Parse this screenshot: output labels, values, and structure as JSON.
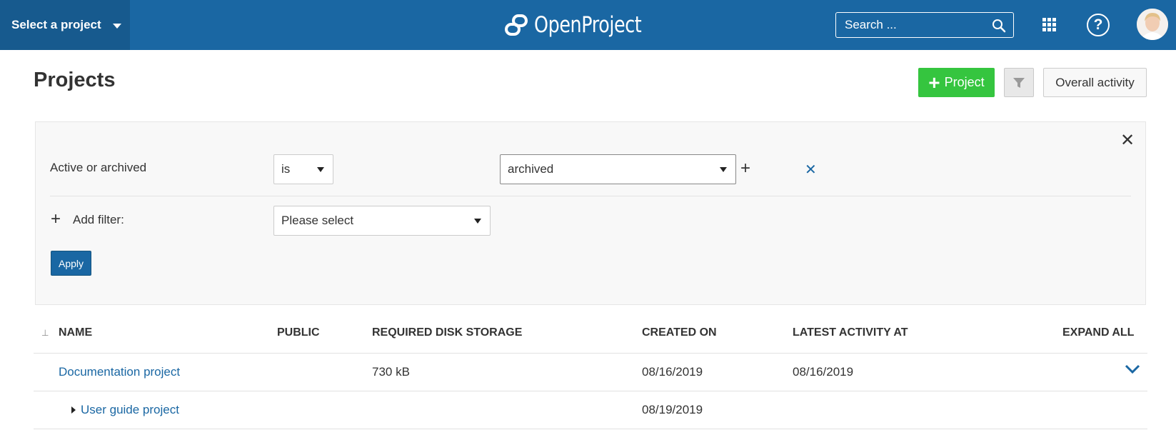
{
  "header": {
    "project_select": "Select a project",
    "logo_text": "OpenProject",
    "search_placeholder": "Search ...",
    "brand_color": "#1a67a3"
  },
  "page": {
    "title": "Projects",
    "new_project_label": "Project",
    "overall_activity_label": "Overall activity"
  },
  "filters": {
    "rows": [
      {
        "label": "Active or archived",
        "operator": "is",
        "value": "archived"
      }
    ],
    "add_filter_label": "Add filter:",
    "add_filter_placeholder": "Please select",
    "apply_label": "Apply"
  },
  "table": {
    "columns": [
      "NAME",
      "PUBLIC",
      "REQUIRED DISK STORAGE",
      "CREATED ON",
      "LATEST ACTIVITY AT",
      "EXPAND ALL"
    ],
    "rows": [
      {
        "name": "Documentation project",
        "public": "",
        "disk_storage": "730 kB",
        "created_on": "08/16/2019",
        "latest_activity": "08/16/2019"
      },
      {
        "name": "User guide project",
        "public": "",
        "disk_storage": "",
        "created_on": "08/19/2019",
        "latest_activity": ""
      }
    ]
  }
}
